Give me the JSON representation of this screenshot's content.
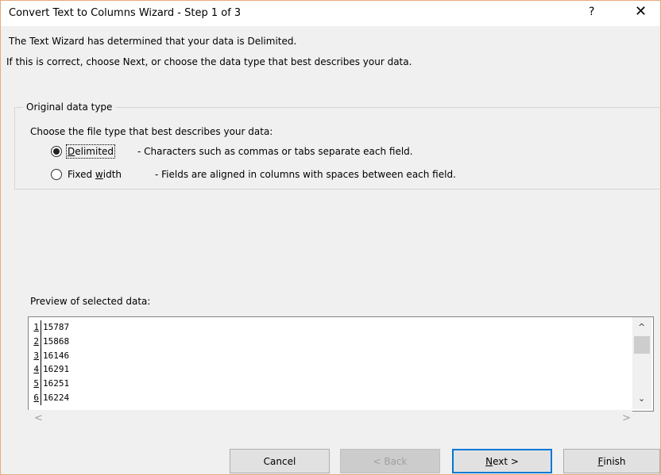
{
  "window": {
    "title": "Convert Text to Columns Wizard - Step 1 of 3",
    "help_label": "?",
    "close_label": "✕"
  },
  "intro": {
    "line1": "The Text Wizard has determined that your data is Delimited.",
    "line2": "If this is correct, choose Next, or choose the data type that best describes your data."
  },
  "original_data_type": {
    "legend": "Original data type",
    "prompt": "Choose the file type that best describes your data:",
    "options": [
      {
        "pre": "",
        "access_key": "D",
        "post": "elimited",
        "description": "- Characters such as commas or tabs separate each field.",
        "selected": true
      },
      {
        "pre": "Fixed ",
        "access_key": "w",
        "post": "idth",
        "description": "- Fields are aligned in columns with spaces between each field.",
        "selected": false
      }
    ]
  },
  "preview": {
    "label": "Preview of selected data:",
    "rows": [
      {
        "num": "1",
        "value": "15787"
      },
      {
        "num": "2",
        "value": "15868"
      },
      {
        "num": "3",
        "value": "16146"
      },
      {
        "num": "4",
        "value": "16291"
      },
      {
        "num": "5",
        "value": "16251"
      },
      {
        "num": "6",
        "value": "16224"
      }
    ]
  },
  "buttons": {
    "cancel": "Cancel",
    "back": "< Back",
    "next_key": "N",
    "next_rest": "ext >",
    "finish_key": "F",
    "finish_rest": "inish"
  },
  "icons": {
    "scroll_up": "^",
    "scroll_down": "⌄",
    "scroll_left": "<",
    "scroll_right": ">"
  }
}
